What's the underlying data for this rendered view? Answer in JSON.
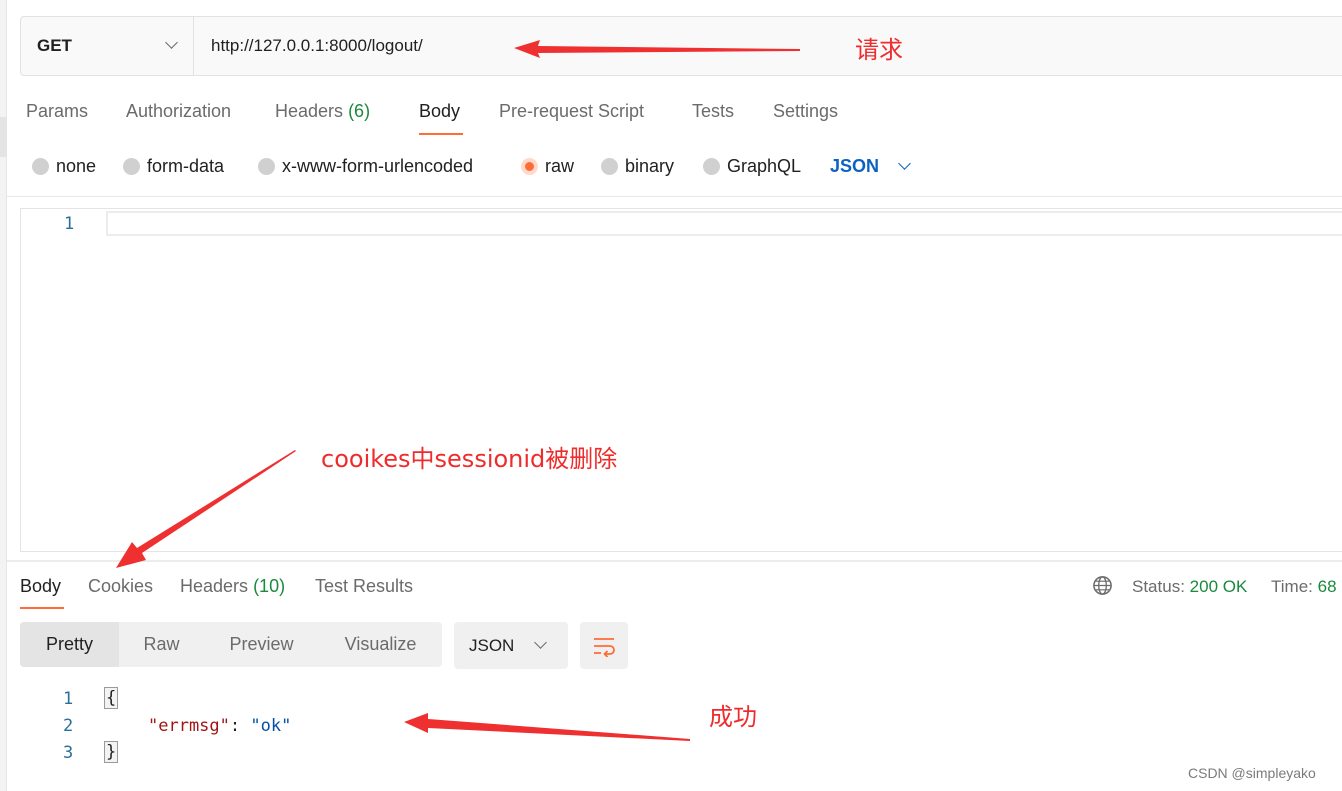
{
  "request": {
    "method": "GET",
    "url": "http://127.0.0.1:8000/logout/"
  },
  "request_tabs": [
    {
      "label": "Params"
    },
    {
      "label": "Authorization"
    },
    {
      "label": "Headers",
      "count": "(6)"
    },
    {
      "label": "Body"
    },
    {
      "label": "Pre-request Script"
    },
    {
      "label": "Tests"
    },
    {
      "label": "Settings"
    }
  ],
  "active_request_tab": "Body",
  "body_types": [
    {
      "label": "none"
    },
    {
      "label": "form-data"
    },
    {
      "label": "x-www-form-urlencoded"
    },
    {
      "label": "raw"
    },
    {
      "label": "binary"
    },
    {
      "label": "GraphQL"
    }
  ],
  "selected_body_type": "raw",
  "body_format": "JSON",
  "editor": {
    "line_numbers": [
      "1"
    ]
  },
  "response_tabs": [
    {
      "label": "Body"
    },
    {
      "label": "Cookies"
    },
    {
      "label": "Headers",
      "count": "(10)"
    },
    {
      "label": "Test Results"
    }
  ],
  "active_response_tab": "Body",
  "status": {
    "label": "Status:",
    "value": "200 OK",
    "time_label": "Time:",
    "time_value": "68"
  },
  "response_views": [
    {
      "label": "Pretty"
    },
    {
      "label": "Raw"
    },
    {
      "label": "Preview"
    },
    {
      "label": "Visualize"
    }
  ],
  "active_response_view": "Pretty",
  "response_format": "JSON",
  "response_body": {
    "line_numbers": [
      "1",
      "2",
      "3"
    ],
    "open_brace": "{",
    "key": "\"errmsg\"",
    "colon": ": ",
    "value": "\"ok\"",
    "close_brace": "}"
  },
  "annotations": {
    "request": "请求",
    "cookies": "cooikes中sessionid被删除",
    "success": "成功"
  },
  "colors": {
    "accent": "#ff6c37",
    "link_blue": "#0b62c4",
    "success_green": "#1a8a3c",
    "annotation_red": "#ef2b2b"
  },
  "icons": {
    "method_dropdown": "chevron-down-icon",
    "format_dropdown": "chevron-down-icon",
    "network": "globe-icon",
    "wrap": "wrap-lines-icon"
  },
  "watermark": "CSDN @simpleyako"
}
